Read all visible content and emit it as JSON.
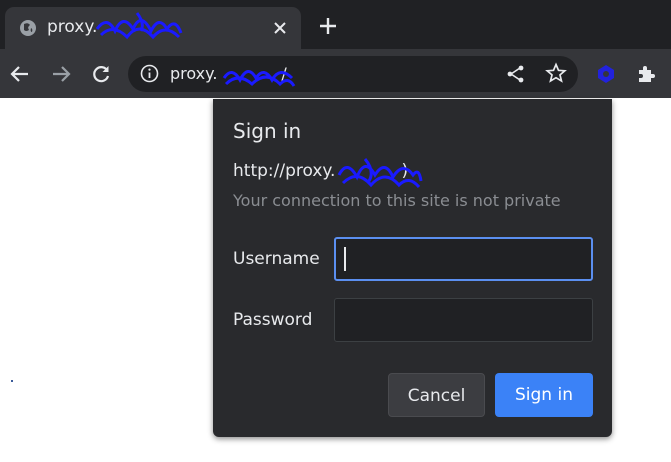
{
  "browser": {
    "tab": {
      "title": "proxy.",
      "favicon": "globe-icon",
      "close_icon": "close-icon"
    },
    "newtab_icon": "plus-icon",
    "toolbar": {
      "back_icon": "arrow-left-icon",
      "forward_icon": "arrow-right-icon",
      "reload_icon": "reload-icon",
      "share_icon": "share-icon",
      "bookmark_icon": "star-icon",
      "extension_icon": "extension-badge-icon",
      "extensions_icon": "puzzle-icon"
    },
    "omnibox": {
      "info_icon": "info-icon",
      "url": "proxy.",
      "url_suffix": "/"
    }
  },
  "dialog": {
    "title": "Sign in",
    "origin": "http://proxy.",
    "origin_suffix": ")",
    "warning": "Your connection to this site is not private",
    "username_label": "Username",
    "username_value": "",
    "password_label": "Password",
    "password_value": "",
    "cancel_label": "Cancel",
    "signin_label": "Sign in"
  },
  "colors": {
    "tabstrip": "#202124",
    "toolbar": "#35363a",
    "dialog": "#292a2d",
    "accent": "#3b82f7",
    "focus_ring": "#5b8ff0",
    "redaction": "#1a1aff"
  }
}
